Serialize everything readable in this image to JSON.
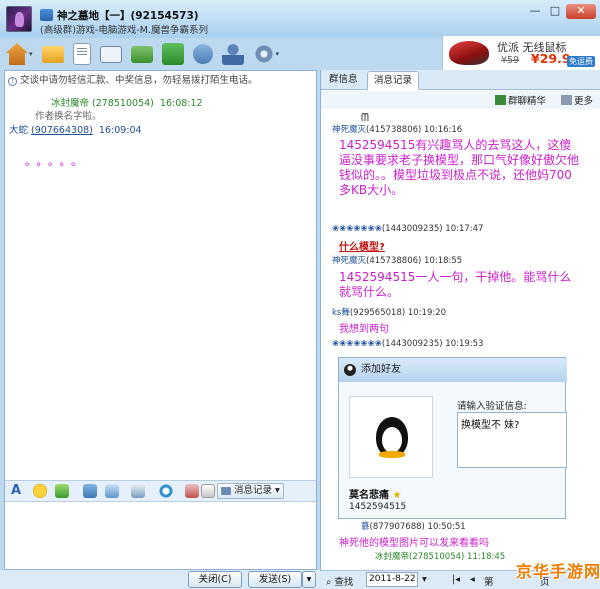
{
  "window": {
    "title": "神之墓地【一】(92154573)",
    "subtitle": "(高级群)游戏-电脑游戏-M.魔兽争霸系列",
    "controls": [
      "—",
      "□",
      "✕"
    ]
  },
  "toolbar": {
    "icons": [
      "house-icon",
      "folder-icon",
      "document-icon",
      "card-icon",
      "mail-icon",
      "share-icon",
      "tools-icon",
      "person-icon",
      "gear-icon"
    ]
  },
  "ad": {
    "title": "优派 无线鼠标",
    "old_price": "¥59",
    "new_price": "¥29.9",
    "badge": "免运费"
  },
  "left": {
    "warning": "交谈中请勿轻信汇款、中奖信息，勿轻易拨打陌生电话。",
    "messages": [
      {
        "name": "冰封魔帝",
        "uid": "(278510054)",
        "time": "16:08:12",
        "body": "作者换名字啦。"
      },
      {
        "name": "大蛇",
        "uid": "(907664308)",
        "time": "16:09:04",
        "body": "。。。。。"
      }
    ],
    "format_bar": {
      "history_label": "消息记录"
    },
    "buttons": {
      "close": "关闭(C)",
      "send": "发送(S)"
    }
  },
  "right": {
    "tabs": [
      "群信息",
      "消息记录"
    ],
    "active_tab": 1,
    "subbar": {
      "essence": "群聊精华",
      "more": "更多"
    },
    "log": [
      {
        "kind": "meta",
        "name": "神死魔灭",
        "uid": "(415738806)",
        "time": "10:16:16"
      },
      {
        "kind": "big",
        "text": "1452594515有兴趣骂人的去骂这人，这傻逼没事要求老子换模型，那口气好像好傲欠他钱似的。。模型垃圾到极点不说，还他妈700多KB大小。"
      },
      {
        "kind": "meta",
        "name": "❀❀❀❀❀❀❀",
        "uid": "(1443009235)",
        "time": "10:17:47"
      },
      {
        "kind": "red",
        "text": "什么模型?"
      },
      {
        "kind": "meta",
        "name": "神死魔灭",
        "uid": "(415738806)",
        "time": "10:18:55"
      },
      {
        "kind": "big",
        "text": "1452594515一人一句，干掉他。能骂什么就骂什么。"
      },
      {
        "kind": "meta",
        "name": "ks舞",
        "uid": "(929565018)",
        "time": "10:19:20"
      },
      {
        "kind": "mid",
        "text": "我想到两句"
      },
      {
        "kind": "meta",
        "name": "❀❀❀❀❀❀❀",
        "uid": "(1443009235)",
        "time": "10:19:53"
      },
      {
        "kind": "meta",
        "name": "慕",
        "uid": "(877907688)",
        "time": "10:50:51"
      },
      {
        "kind": "mid",
        "text": "神死他的模型图片可以发来看看吗"
      },
      {
        "kind": "meta",
        "name": "冰封魔帝",
        "uid": "(278510054)",
        "time": "11:18:45"
      }
    ],
    "popup": {
      "title": "添加好友",
      "verify_label": "请输入验证信息:",
      "verify_value": "换模型不 妹?",
      "name": "莫名悲痛",
      "number": "1452594515"
    },
    "bottom": {
      "search": "查找",
      "date": "2011-8-22",
      "page_prefix": "第",
      "page_suffix": "页"
    }
  },
  "watermark": "京华手游网"
}
